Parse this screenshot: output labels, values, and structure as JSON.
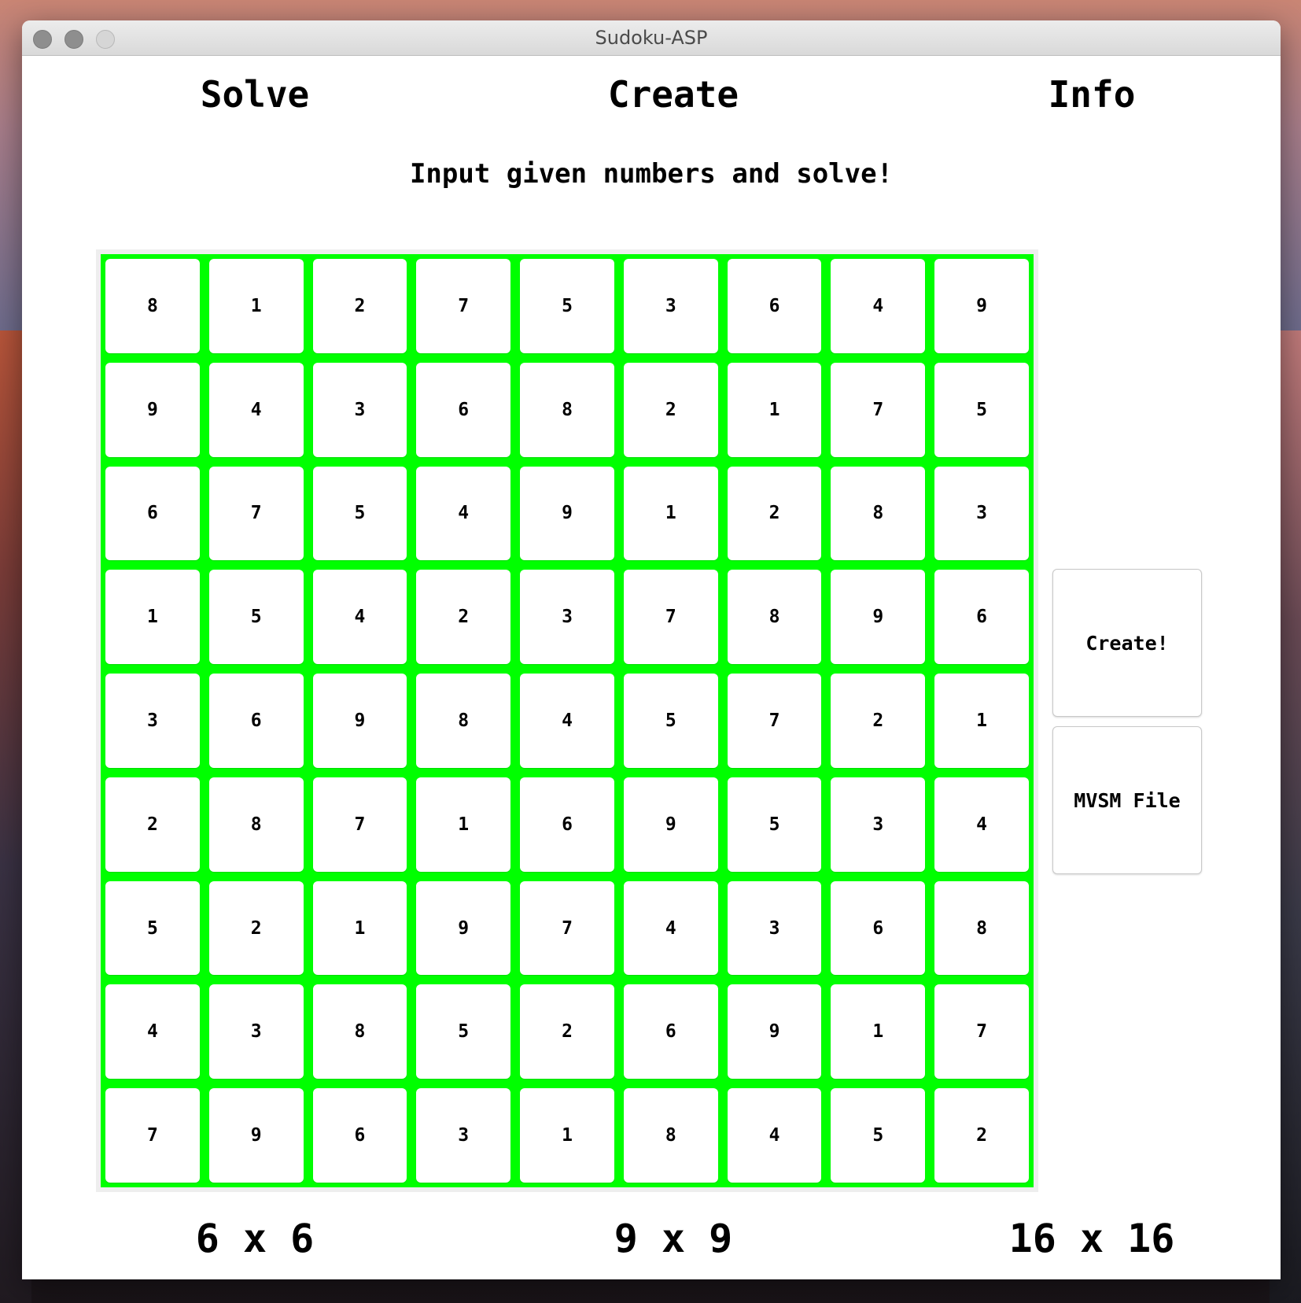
{
  "window": {
    "title": "Sudoku-ASP"
  },
  "tabs": [
    {
      "label": "Solve"
    },
    {
      "label": "Create"
    },
    {
      "label": "Info"
    }
  ],
  "subtitle": "Input given numbers and solve!",
  "board": {
    "highlight_color": "#00ff00",
    "rows": [
      [
        "8",
        "1",
        "2",
        "7",
        "5",
        "3",
        "6",
        "4",
        "9"
      ],
      [
        "9",
        "4",
        "3",
        "6",
        "8",
        "2",
        "1",
        "7",
        "5"
      ],
      [
        "6",
        "7",
        "5",
        "4",
        "9",
        "1",
        "2",
        "8",
        "3"
      ],
      [
        "1",
        "5",
        "4",
        "2",
        "3",
        "7",
        "8",
        "9",
        "6"
      ],
      [
        "3",
        "6",
        "9",
        "8",
        "4",
        "5",
        "7",
        "2",
        "1"
      ],
      [
        "2",
        "8",
        "7",
        "1",
        "6",
        "9",
        "5",
        "3",
        "4"
      ],
      [
        "5",
        "2",
        "1",
        "9",
        "7",
        "4",
        "3",
        "6",
        "8"
      ],
      [
        "4",
        "3",
        "8",
        "5",
        "2",
        "6",
        "9",
        "1",
        "7"
      ],
      [
        "7",
        "9",
        "6",
        "3",
        "1",
        "8",
        "4",
        "5",
        "2"
      ]
    ]
  },
  "actions": {
    "create_label": "Create!",
    "mvsm_label": "MVSM File"
  },
  "sizes": [
    {
      "label": "6 x 6"
    },
    {
      "label": "9 x 9"
    },
    {
      "label": "16 x 16"
    }
  ]
}
